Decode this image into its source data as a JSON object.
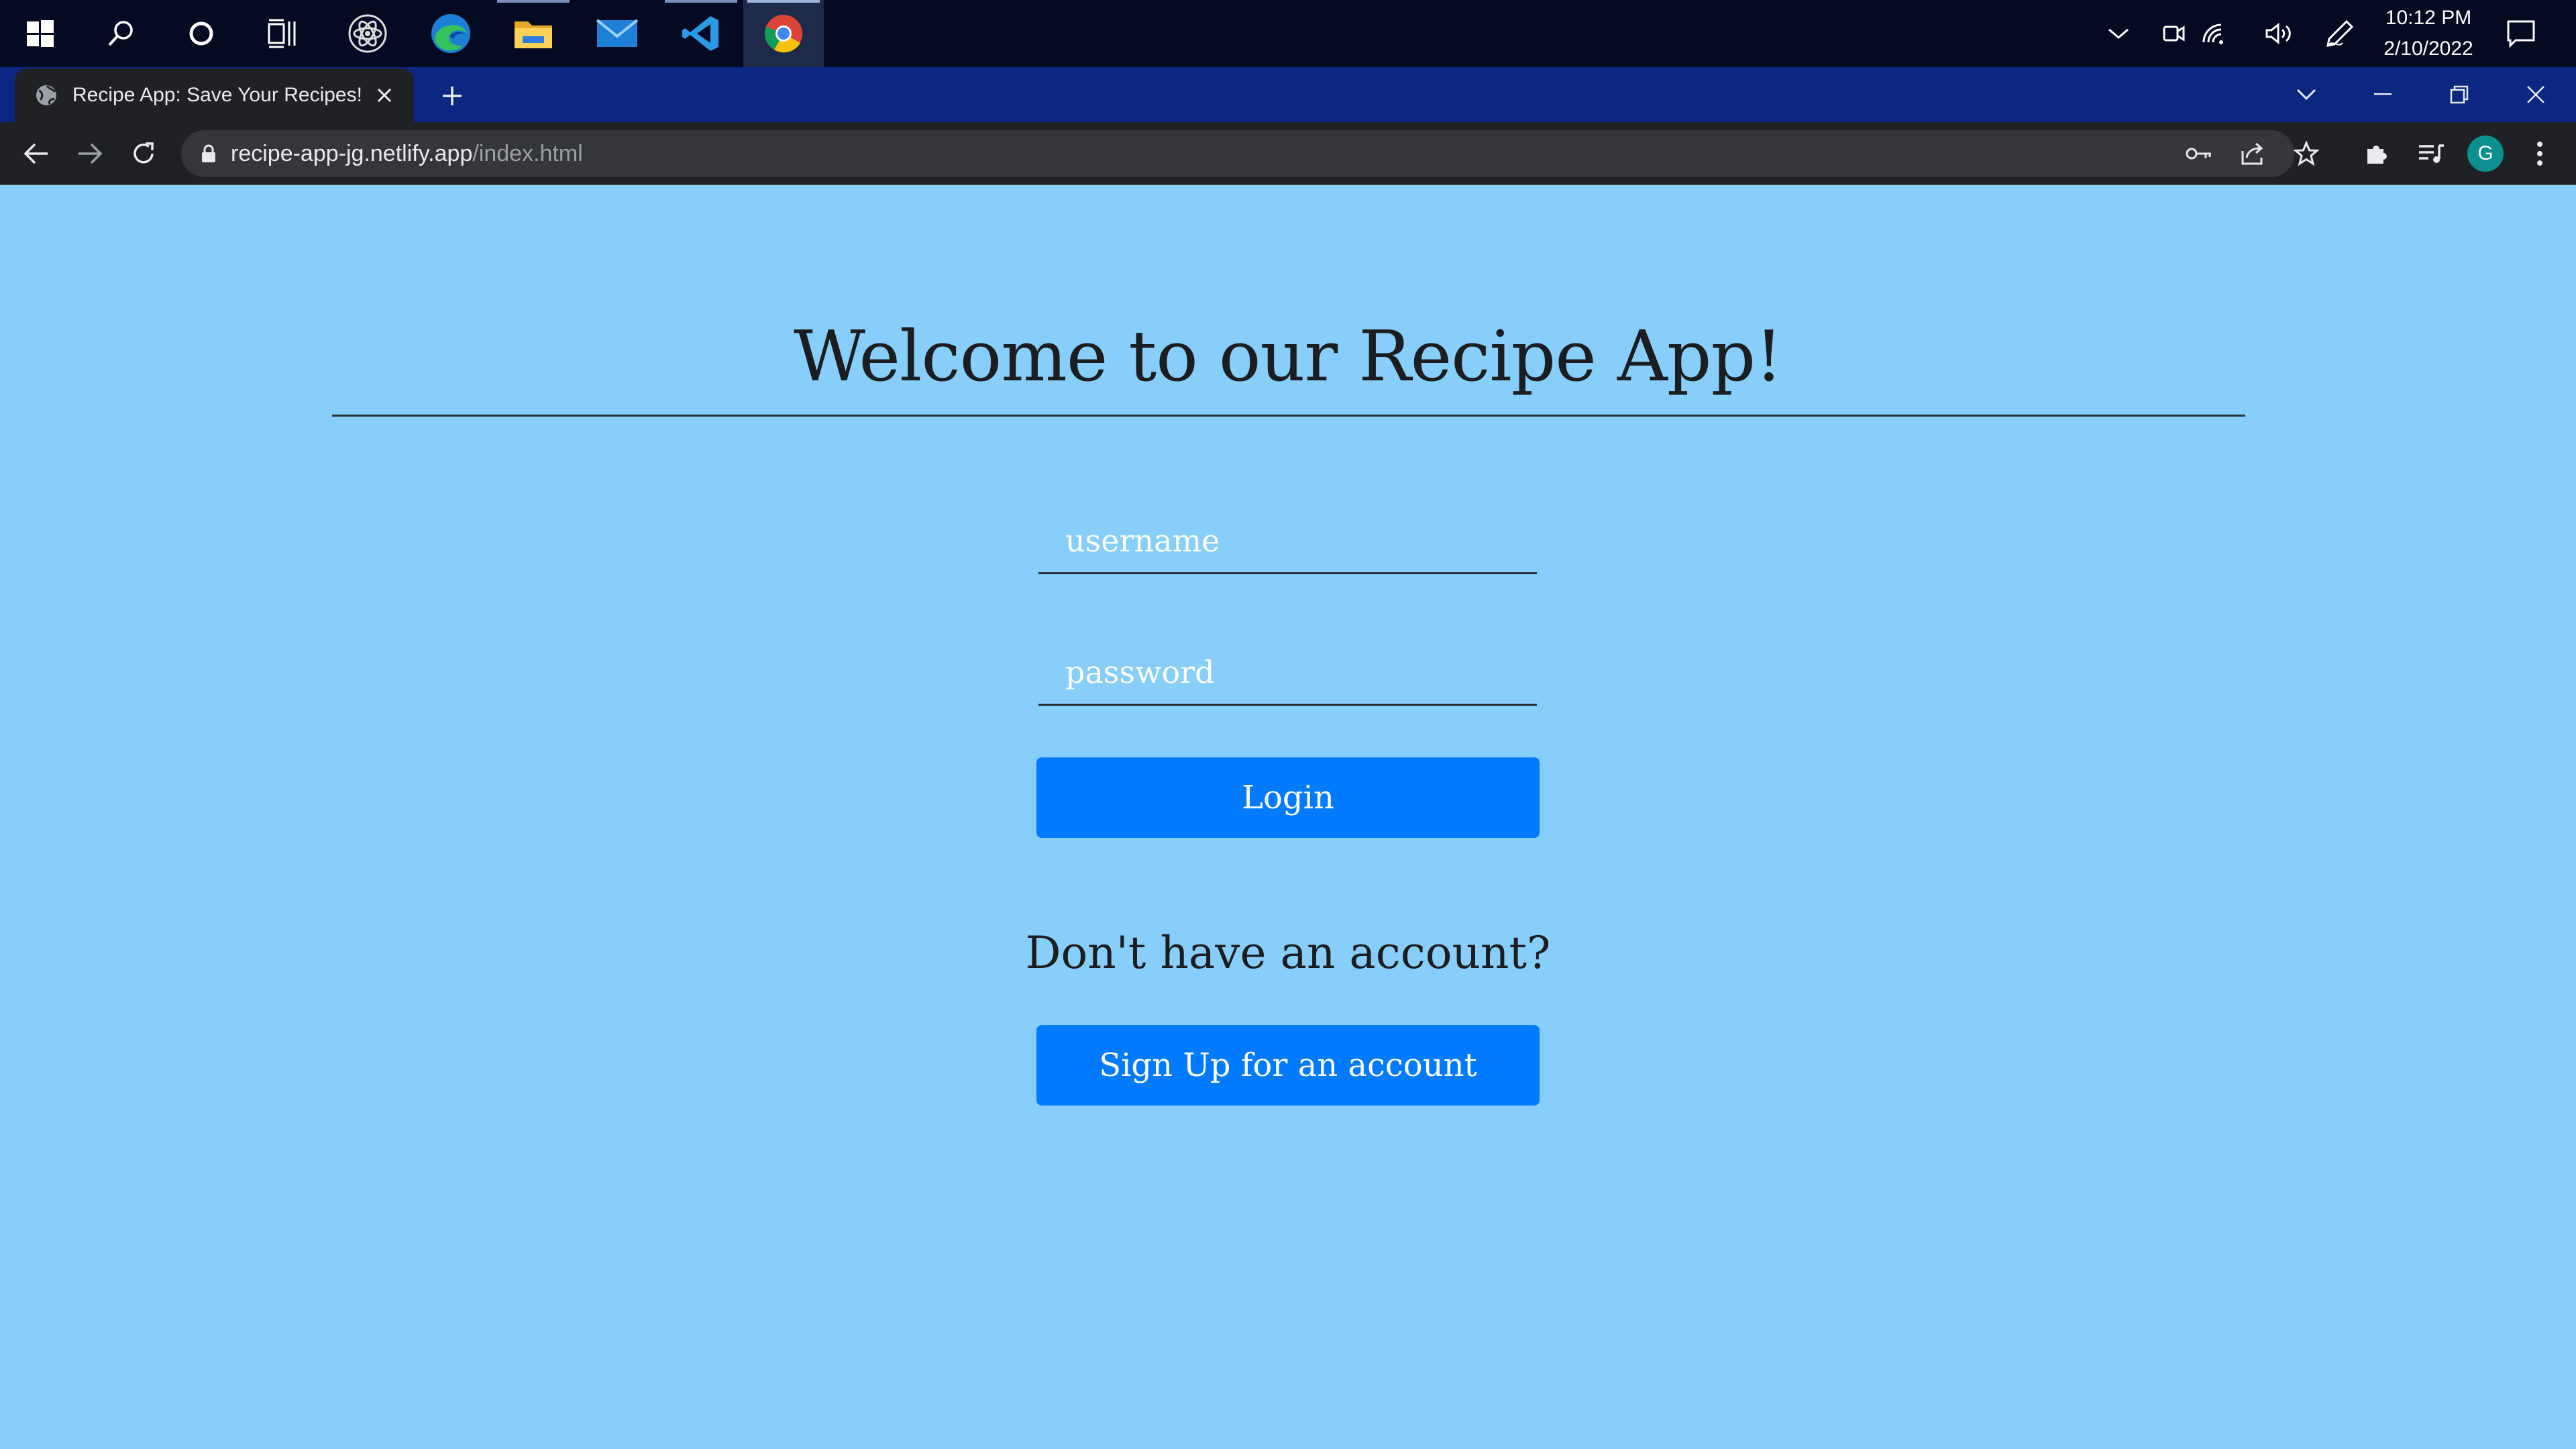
{
  "taskbar": {
    "apps": [
      {
        "name": "start",
        "icon": "windows-logo-icon"
      },
      {
        "name": "search",
        "icon": "search-icon"
      },
      {
        "name": "cortana",
        "icon": "cortana-ring-icon"
      },
      {
        "name": "task-view",
        "icon": "task-view-icon"
      },
      {
        "name": "react-app",
        "icon": "atom-icon"
      },
      {
        "name": "edge",
        "icon": "edge-icon"
      },
      {
        "name": "file-explorer",
        "icon": "folder-icon"
      },
      {
        "name": "mail",
        "icon": "mail-icon"
      },
      {
        "name": "vscode",
        "icon": "vscode-icon"
      },
      {
        "name": "chrome",
        "icon": "chrome-icon"
      }
    ],
    "clock": {
      "time": "10:12 PM",
      "date": "2/10/2022"
    }
  },
  "browser": {
    "tab_title": "Recipe App: Save Your Recipes!",
    "url_host": "recipe-app-jg.netlify.app",
    "url_path": "/index.html",
    "profile_initial": "G"
  },
  "page": {
    "title": "Welcome to our Recipe App!",
    "username_placeholder": "username",
    "password_placeholder": "password",
    "login_label": "Login",
    "no_account_text": "Don't have an account?",
    "signup_label": "Sign Up for an account"
  },
  "colors": {
    "page_bg": "#87cefa",
    "button_bg": "#007bff",
    "taskbar_bg": "#040a22",
    "tabstrip_bg": "#0b2781",
    "toolbar_bg": "#202124"
  }
}
